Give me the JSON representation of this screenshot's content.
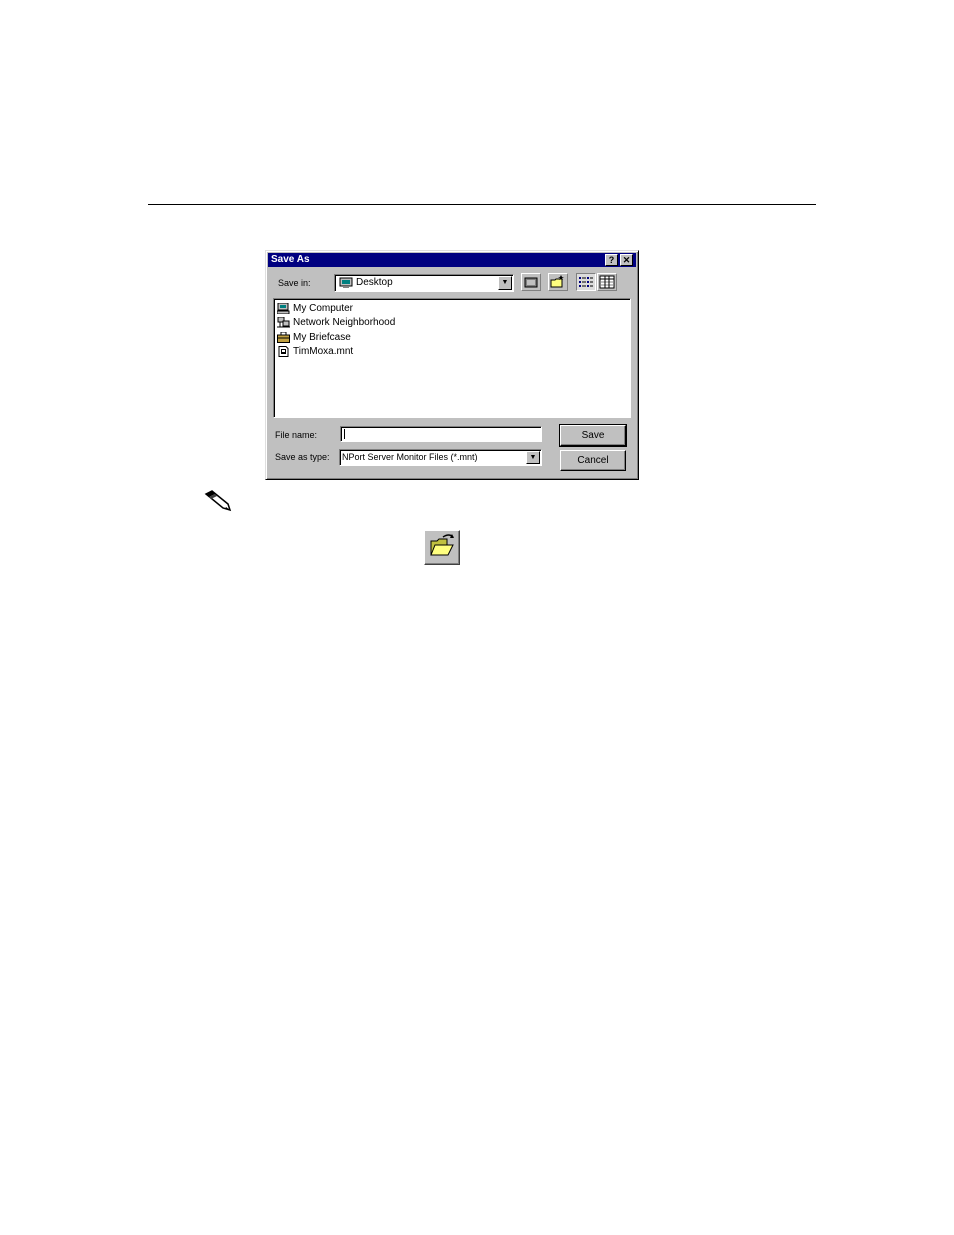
{
  "dialog": {
    "title": "Save As",
    "help_glyph": "?",
    "close_glyph": "✕",
    "save_in_label": "Save in:",
    "save_in_value": "Desktop",
    "toolbar_icons": [
      "up-one-level-icon",
      "create-new-folder-icon",
      "list-view-icon",
      "details-view-icon"
    ],
    "files": [
      {
        "name": "My Computer",
        "icon": "computer-icon"
      },
      {
        "name": "Network Neighborhood",
        "icon": "network-icon"
      },
      {
        "name": "My Briefcase",
        "icon": "briefcase-icon"
      },
      {
        "name": "TimMoxa.mnt",
        "icon": "file-icon"
      }
    ],
    "file_name_label": "File name:",
    "file_name_value": "",
    "save_as_type_label": "Save as type:",
    "save_as_type_value": "NPort Server Monitor Files (*.mnt)",
    "save_button": "Save",
    "cancel_button": "Cancel"
  },
  "colors": {
    "titlebar": "#000080",
    "face": "#c0c0c0"
  },
  "page_icons": [
    "note-pencil-icon",
    "open-file-button-icon"
  ]
}
